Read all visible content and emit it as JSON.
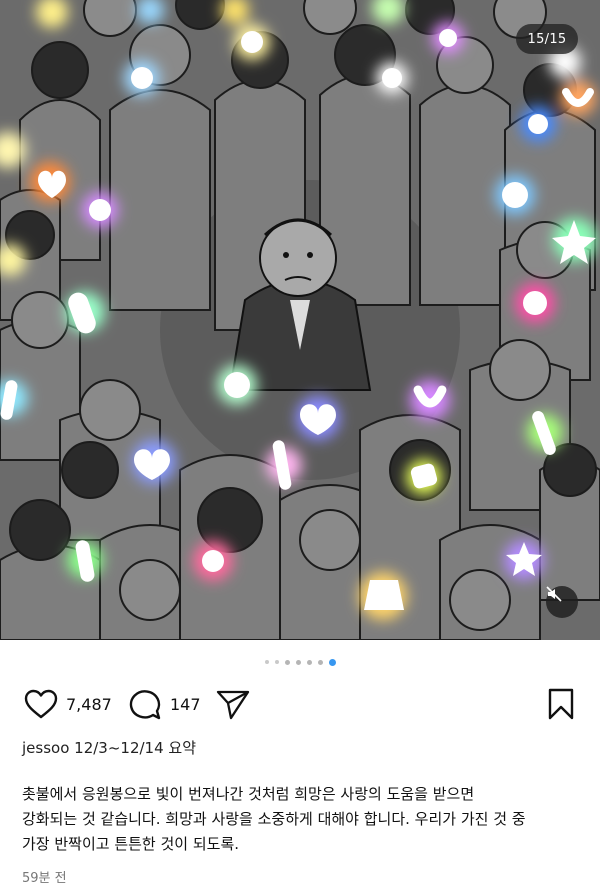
{
  "post": {
    "counter": "15/15",
    "image_subject": "crowd-with-lightsticks-around-man",
    "pagination": {
      "count": 7,
      "active": 7
    }
  },
  "actions": {
    "likes": "7,487",
    "comments": "147"
  },
  "caption": {
    "author_line": "jessoo 12/3~12/14 요약",
    "lines": [
      "촛불에서 응원봉으로 빛이 번져나간 것처럼 희망은 사랑의 도움을 받으면",
      "강화되는 것 같습니다. 희망과 사랑을 소중하게 대해야 합니다. 우리가 가진 것 중",
      "가장 반짝이고 튼튼한 것이 되도록."
    ],
    "timestamp": "59분 전"
  },
  "icons": {
    "like": "heart-outline-icon",
    "comment": "speech-bubble-icon",
    "share": "paper-plane-icon",
    "save": "bookmark-icon",
    "mute": "speaker-muted-icon"
  },
  "colors": {
    "accent_dot": "#3797f0",
    "illustration_bg": "#6a6a6a"
  }
}
